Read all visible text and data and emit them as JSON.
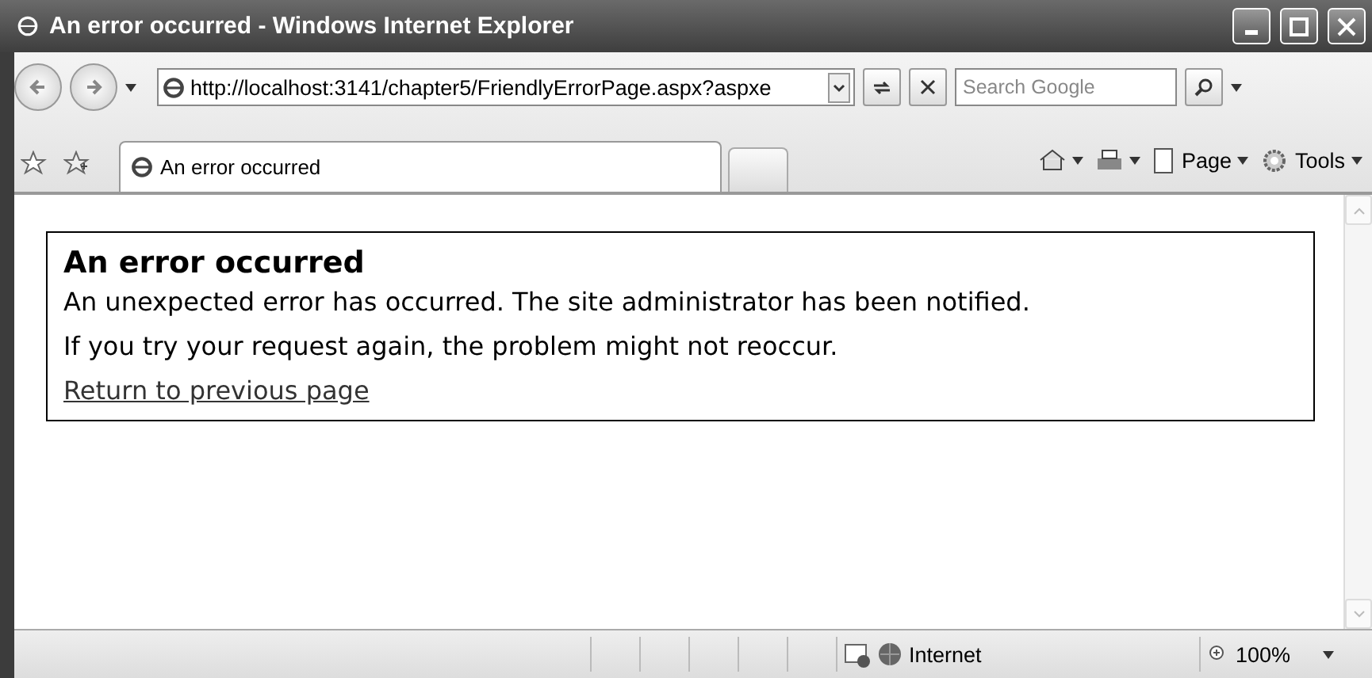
{
  "window": {
    "title": "An error occurred - Windows Internet Explorer"
  },
  "address_bar": {
    "url": "http://localhost:3141/chapter5/FriendlyErrorPage.aspx?aspxe"
  },
  "search": {
    "placeholder": "Search Google"
  },
  "tabs": [
    {
      "label": "An error occurred",
      "selected": true
    }
  ],
  "commands": [
    {
      "label": "Page"
    },
    {
      "label": "Tools"
    }
  ],
  "page": {
    "heading": "An error occurred",
    "paragraphs": [
      "An unexpected error has occurred. The site administrator has been notified.",
      "If you try your request again, the problem might not reoccur."
    ],
    "link": "Return to previous page"
  },
  "status_bar": {
    "zone": "Internet",
    "zoom": "100%"
  }
}
